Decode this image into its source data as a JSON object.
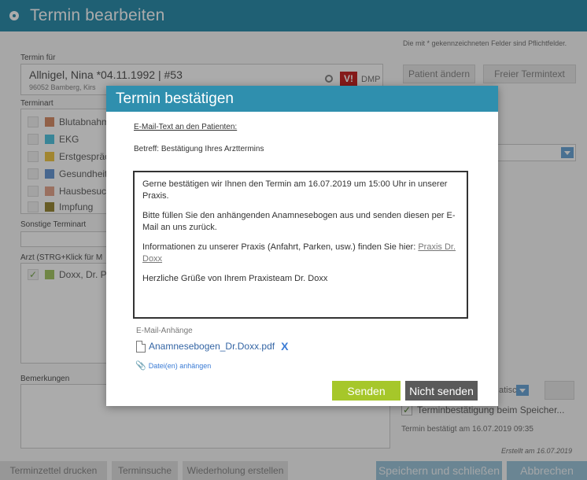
{
  "window": {
    "title": "Termin bearbeiten"
  },
  "form": {
    "required_note": "Die mit * gekennzeichneten Felder sind Pflichtfelder.",
    "termin_fuer_label": "Termin für",
    "patient_name": "Allnigel, Nina *04.11.1992 | #53",
    "patient_address": "96052 Bamberg, Kirs",
    "badge": "V!",
    "dmp": "DMP",
    "patient_aendern": "Patient ändern",
    "freier_termintext": "Freier Termintext",
    "terminart_label": "Terminart",
    "terminart_items": [
      {
        "label": "Blutabnahm",
        "color": "#d98f6a"
      },
      {
        "label": "EKG",
        "color": "#56c7e2"
      },
      {
        "label": "Erstgespräch",
        "color": "#f0c84a"
      },
      {
        "label": "Gesundheits",
        "color": "#6b9ad6"
      },
      {
        "label": "Hausbesuch",
        "color": "#e6a890"
      },
      {
        "label": "Impfung",
        "color": "#9a8a3a"
      }
    ],
    "sonstige_label": "Sonstige Terminart",
    "arzt_label": "Arzt  (STRG+Klick für M",
    "arzt_check": "✓",
    "arzt_color": "#a8c868",
    "arzt_name": "Doxx, Dr. Pa",
    "bemerkungen_label": "Bemerkungen",
    "side_field_text": "atisc",
    "confirm_check": "✓",
    "confirm_text": "Terminbestätigung beim Speicher...",
    "confirmed_text": "Termin bestätigt am 16.07.2019 09:35",
    "created_text": "Erstellt am 16.07.2019"
  },
  "footer": {
    "print": "Terminzettel drucken",
    "search": "Terminsuche",
    "repeat": "Wiederholung erstellen",
    "save_close": "Speichern und schließen",
    "cancel": "Abbrechen"
  },
  "dialog": {
    "title": "Termin bestätigen",
    "mail_text_label": "E-Mail-Text an den Patienten:",
    "subject": "Betreff: Bestätigung Ihres Arzttermins",
    "body": {
      "p1": "Gerne bestätigen wir Ihnen den Termin am 16.07.2019 um 15:00 Uhr in unserer Praxis.",
      "p2": "Bitte füllen Sie den anhängenden Anamnesebogen aus und senden diesen per E-Mail an uns zurück.",
      "p3_prefix": "Informationen zu unserer Praxis (Anfahrt, Parken, usw.) finden Sie hier: ",
      "p3_link": "Praxis Dr. Doxx",
      "p4": "Herzliche Grüße von Ihrem Praxisteam Dr. Doxx"
    },
    "attachments_label": "E-Mail-Anhänge",
    "attachment_file": "Anamnesebogen_Dr.Doxx.pdf",
    "remove_symbol": "X",
    "attach_link": "Datei(en) anhängen",
    "send": "Senden",
    "dont_send": "Nicht senden"
  }
}
